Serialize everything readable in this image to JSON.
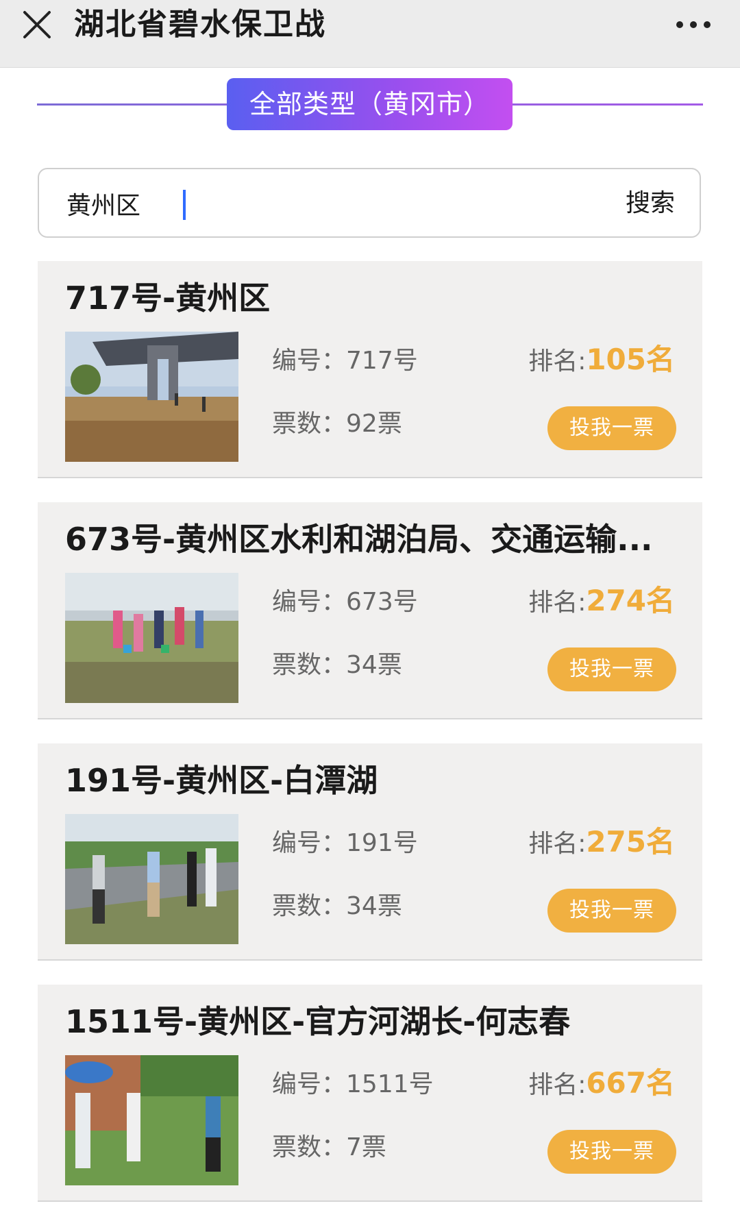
{
  "header": {
    "title": "湖北省碧水保卫战",
    "close_icon": "close-icon",
    "more_icon": "more-icon"
  },
  "category": {
    "label": "全部类型（黄冈市）"
  },
  "search": {
    "value": "黄州区",
    "button_label": "搜索"
  },
  "labels": {
    "id_prefix": "编号：",
    "votes_prefix": "票数：",
    "rank_prefix": "排名:",
    "vote_button": "投我一票"
  },
  "entries": [
    {
      "title": "717号-黄州区",
      "id": "717号",
      "votes": "92票",
      "rank": "105名"
    },
    {
      "title": "673号-黄州区水利和湖泊局、交通运输...",
      "id": "673号",
      "votes": "34票",
      "rank": "274名"
    },
    {
      "title": "191号-黄州区-白潭湖",
      "id": "191号",
      "votes": "34票",
      "rank": "275名"
    },
    {
      "title": "1511号-黄州区-官方河湖长-何志春",
      "id": "1511号",
      "votes": "7票",
      "rank": "667名"
    }
  ],
  "colors": {
    "accent_gradient_start": "#5a5ff0",
    "accent_gradient_end": "#c34ff0",
    "rank_color": "#f0ac3a",
    "vote_button_bg": "#f1b041"
  }
}
